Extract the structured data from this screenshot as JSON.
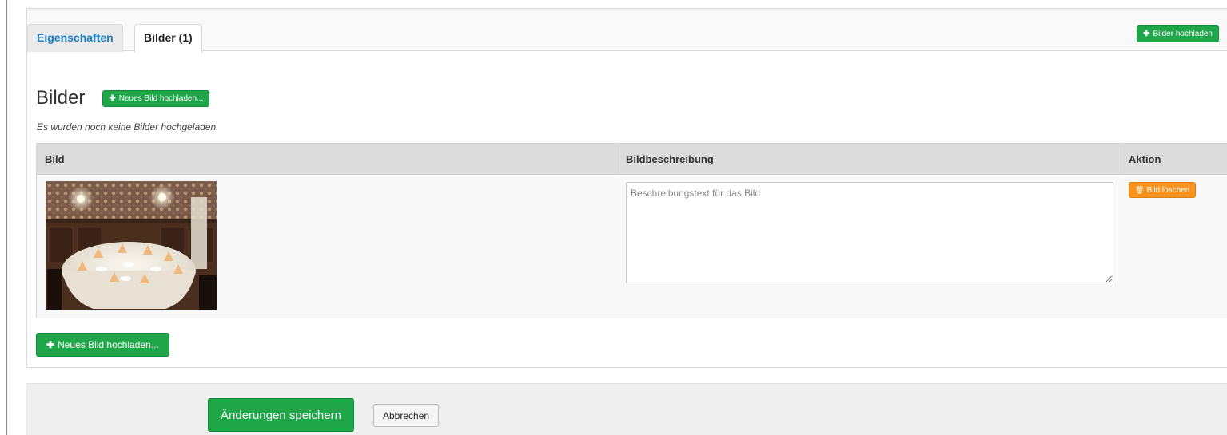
{
  "tabs": [
    {
      "label": "Eigenschaften"
    },
    {
      "label": "Bilder (1)"
    }
  ],
  "top_upload_label": "Bilder hochladen",
  "section": {
    "heading": "Bilder",
    "upload_label": "Neues Bild hochladen...",
    "note": "Es wurden noch keine Bilder hochgeladen."
  },
  "table": {
    "headers": [
      "Bild",
      "Bildbeschreibung",
      "Aktion"
    ],
    "rows": [
      {
        "description_placeholder": "Beschreibungstext für das Bild",
        "delete_label": "Bild löschen"
      }
    ]
  },
  "bottom_upload_label": "Neues Bild hochladen...",
  "footer": {
    "save_label": "Änderungen speichern",
    "cancel_label": "Abbrechen"
  },
  "colors": {
    "accent_green": "#1fa648",
    "delete_orange": "#f7931e",
    "tab_link_blue": "#1c7fc4"
  },
  "icons": {
    "plus": "plus-icon",
    "trash": "trash-icon"
  }
}
